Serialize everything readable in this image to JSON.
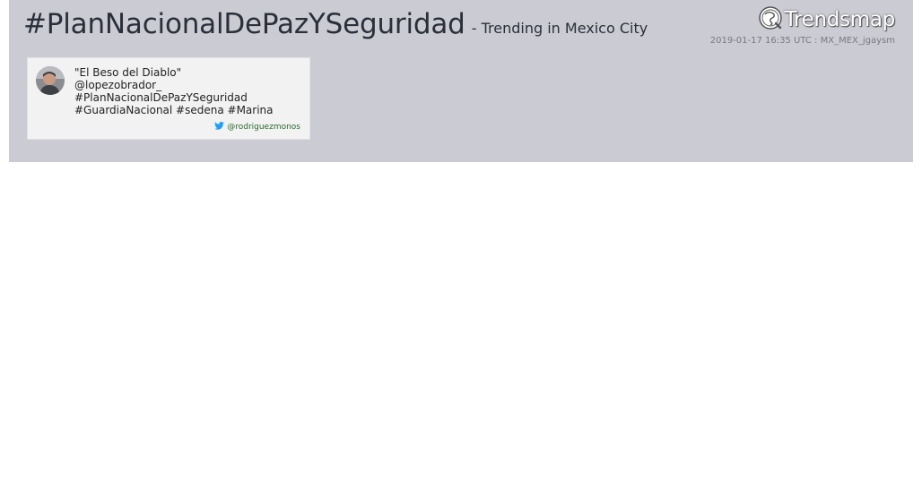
{
  "header": {
    "hashtag": "#PlanNacionalDePazYSeguridad",
    "subtitle": "- Trending in Mexico City",
    "meta": "2019-01-17 16:35 UTC : MX_MEX_jgaysm",
    "logo_text": "Trendsmap"
  },
  "tweet": {
    "lines": [
      "\"El Beso del Diablo\"",
      "@lopezobrador_",
      "#PlanNacionalDePazYSeguridad",
      "#GuardiaNacional #sedena #Marina"
    ],
    "author": "@rodriguezmonos"
  },
  "colors": {
    "banner": "#cbccd3",
    "card": "#f2f2f3",
    "author": "#2b6a2b",
    "twitter": "#1da1f2"
  },
  "icons": [
    "trendsmap-globe-icon",
    "twitter-bird-icon",
    "avatar"
  ]
}
